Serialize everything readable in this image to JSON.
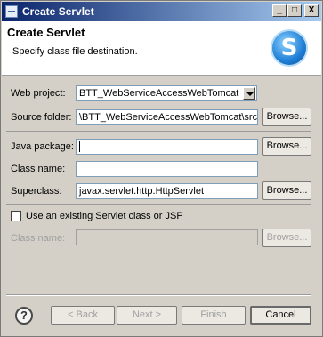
{
  "window": {
    "title": "Create Servlet",
    "controls": {
      "minimize": "_",
      "maximize": "□",
      "close": "X"
    }
  },
  "banner": {
    "title": "Create Servlet",
    "description": "Specify class file destination.",
    "logo_letter": "S"
  },
  "form": {
    "web_project": {
      "label": "Web project:",
      "value": "BTT_WebServiceAccessWebTomcat"
    },
    "source_folder": {
      "label": "Source folder:",
      "value": "\\BTT_WebServiceAccessWebTomcat\\src",
      "browse": "Browse..."
    },
    "java_package": {
      "label": "Java package:",
      "value": "",
      "browse": "Browse..."
    },
    "class_name": {
      "label": "Class name:",
      "value": ""
    },
    "superclass": {
      "label": "Superclass:",
      "value": "javax.servlet.http.HttpServlet",
      "browse": "Browse..."
    },
    "existing_servlet": {
      "label": "Use an existing Servlet class or JSP",
      "checked": false
    },
    "existing_class_name": {
      "label": "Class name:",
      "value": "",
      "browse": "Browse..."
    }
  },
  "footer": {
    "help_label": "?",
    "back": "< Back",
    "next": "Next >",
    "finish": "Finish",
    "cancel": "Cancel"
  }
}
